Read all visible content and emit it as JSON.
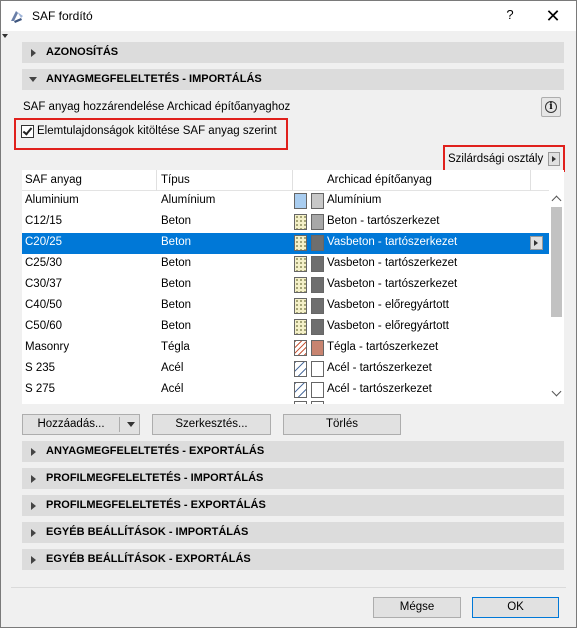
{
  "window": {
    "title": "SAF fordító",
    "help_label": "?",
    "close_label": "✕"
  },
  "sections": {
    "identification": "AZONOSÍTÁS",
    "material_import": "ANYAGMEGFELELTETÉS - IMPORTÁLÁS",
    "material_export": "ANYAGMEGFELELTETÉS - EXPORTÁLÁS",
    "profile_import": "PROFILMEGFELELTETÉS - IMPORTÁLÁS",
    "profile_export": "PROFILMEGFELELTETÉS - EXPORTÁLÁS",
    "other_import": "EGYÉB BEÁLLÍTÁSOK - IMPORTÁLÁS",
    "other_export": "EGYÉB BEÁLLÍTÁSOK - EXPORTÁLÁS"
  },
  "material_import": {
    "assign_label": "SAF anyag hozzárendelése Archicad építőanyaghoz",
    "info_icon_label": "i",
    "checkbox_label": "Elemtulajdonságok kitöltése SAF anyag szerint",
    "checkbox_checked": true,
    "strength_button_label": "Szilárdsági osztály",
    "table": {
      "headers": [
        "SAF anyag",
        "Típus",
        "Archicad építőanyag"
      ],
      "rows": [
        {
          "saf": "Aluminium",
          "type": "Alumínium",
          "material": "Alumínium",
          "fill": "solid-blue",
          "color": "#c8c8c8"
        },
        {
          "saf": "C12/15",
          "type": "Beton",
          "material": "Beton - tartószerkezet",
          "fill": "concrete",
          "color": "#a8a8a8"
        },
        {
          "saf": "C20/25",
          "type": "Beton",
          "material": "Vasbeton - tartószerkezet",
          "fill": "concrete",
          "color": "#6e6e6e",
          "selected": true
        },
        {
          "saf": "C25/30",
          "type": "Beton",
          "material": "Vasbeton - tartószerkezet",
          "fill": "concrete",
          "color": "#6e6e6e"
        },
        {
          "saf": "C30/37",
          "type": "Beton",
          "material": "Vasbeton - tartószerkezet",
          "fill": "concrete",
          "color": "#6e6e6e"
        },
        {
          "saf": "C40/50",
          "type": "Beton",
          "material": "Vasbeton - előregyártott",
          "fill": "concrete",
          "color": "#6e6e6e"
        },
        {
          "saf": "C50/60",
          "type": "Beton",
          "material": "Vasbeton - előregyártott",
          "fill": "concrete",
          "color": "#6e6e6e"
        },
        {
          "saf": "Masonry",
          "type": "Tégla",
          "material": "Tégla - tartószerkezet",
          "fill": "brick",
          "color": "#c88470"
        },
        {
          "saf": "S 235",
          "type": "Acél",
          "material": "Acél - tartószerkezet",
          "fill": "steel",
          "color": "#ffffff"
        },
        {
          "saf": "S 275",
          "type": "Acél",
          "material": "Acél - tartószerkezet",
          "fill": "steel",
          "color": "#ffffff"
        }
      ]
    },
    "buttons": {
      "add": "Hozzáadás...",
      "edit": "Szerkesztés...",
      "delete": "Törlés"
    }
  },
  "footer": {
    "cancel": "Mégse",
    "ok": "OK"
  },
  "colors": {
    "selection": "#0078d7",
    "section_header": "#dcdcdc",
    "highlight_box": "#e0201c"
  }
}
